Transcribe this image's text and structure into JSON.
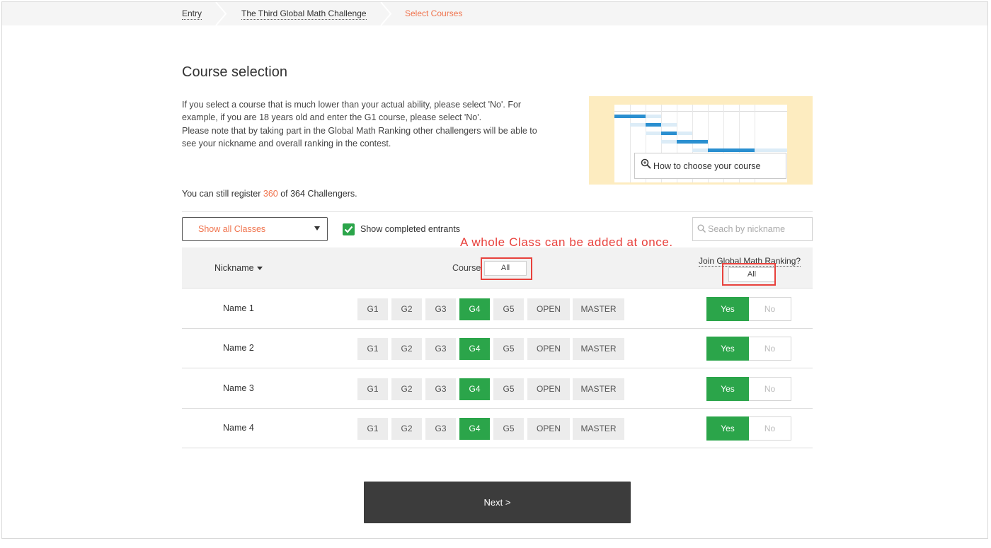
{
  "breadcrumb": {
    "items": [
      {
        "label": "Entry"
      },
      {
        "label": "The Third Global Math Challenge"
      },
      {
        "label": "Select Courses"
      }
    ]
  },
  "page": {
    "title": "Course selection",
    "intro_lines": [
      "If you select a course that is much lower than your actual ability, please select 'No'. For",
      "example, if you are 18 years old and enter the G1 course, please select 'No'.",
      "Please note that by taking part in the Global Math Ranking other challengers will be able to",
      "see your nickname and overall ranking in the contest."
    ],
    "guide_link": "How to choose your course",
    "remaining": {
      "prefix": "You can still register ",
      "count": "360",
      "suffix": " of 364 Challengers."
    }
  },
  "filters": {
    "class_select": "Show all Classes",
    "show_completed_label": "Show completed entrants",
    "show_completed_checked": true,
    "search_placeholder": "Seach by nickname"
  },
  "annotation": "A whole Class can be added at once.",
  "table": {
    "col_nickname": "Nickname",
    "col_course": "Course",
    "col_course_all": "All",
    "col_join": "Join Global Math Ranking?",
    "col_join_all": "All",
    "course_options": [
      "G1",
      "G2",
      "G3",
      "G4",
      "G5",
      "OPEN",
      "MASTER"
    ],
    "yes_label": "Yes",
    "no_label": "No",
    "rows": [
      {
        "name": "Name 1",
        "course": "G4",
        "join": "Yes"
      },
      {
        "name": "Name 2",
        "course": "G4",
        "join": "Yes"
      },
      {
        "name": "Name 3",
        "course": "G4",
        "join": "Yes"
      },
      {
        "name": "Name 4",
        "course": "G4",
        "join": "Yes"
      }
    ]
  },
  "next_button": "Next >",
  "colors": {
    "accent": "#f0734d",
    "selected": "#2ba54a",
    "annotation": "#e8413c",
    "dark_button": "#3c3c3c"
  }
}
